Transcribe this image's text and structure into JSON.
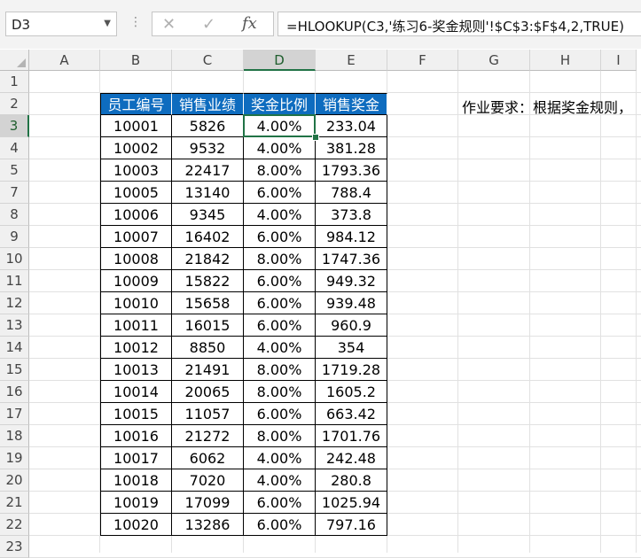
{
  "name_box": "D3",
  "formula": "=HLOOKUP(C3,'练习6-奖金规则'!$C$3:$F$4,2,TRUE)",
  "icons": {
    "cancel": "x-icon",
    "enter": "checkmark-icon",
    "function": "fx-icon",
    "more": "vertical-dots-icon",
    "dropdown": "chevron-down-icon"
  },
  "columns": [
    "A",
    "B",
    "C",
    "D",
    "E",
    "F",
    "G",
    "H",
    "I"
  ],
  "rows": [
    "1",
    "2",
    "3",
    "4",
    "5",
    "7",
    "8",
    "9",
    "10",
    "11",
    "12",
    "13",
    "14",
    "15",
    "16",
    "17",
    "18",
    "19",
    "20",
    "21",
    "22",
    "23"
  ],
  "selected_cell": {
    "column": "D",
    "row": "3"
  },
  "table": {
    "headers": [
      "员工编号",
      "销售业绩",
      "奖金比例",
      "销售奖金"
    ],
    "header_color": "#0E6CBF",
    "rows": [
      [
        "10001",
        "5826",
        "4.00%",
        "233.04"
      ],
      [
        "10002",
        "9532",
        "4.00%",
        "381.28"
      ],
      [
        "10003",
        "22417",
        "8.00%",
        "1793.36"
      ],
      [
        "10005",
        "13140",
        "6.00%",
        "788.4"
      ],
      [
        "10006",
        "9345",
        "4.00%",
        "373.8"
      ],
      [
        "10007",
        "16402",
        "6.00%",
        "984.12"
      ],
      [
        "10008",
        "21842",
        "8.00%",
        "1747.36"
      ],
      [
        "10009",
        "15822",
        "6.00%",
        "949.32"
      ],
      [
        "10010",
        "15658",
        "6.00%",
        "939.48"
      ],
      [
        "10011",
        "16015",
        "6.00%",
        "960.9"
      ],
      [
        "10012",
        "8850",
        "4.00%",
        "354"
      ],
      [
        "10013",
        "21491",
        "8.00%",
        "1719.28"
      ],
      [
        "10014",
        "20065",
        "8.00%",
        "1605.2"
      ],
      [
        "10015",
        "11057",
        "6.00%",
        "663.42"
      ],
      [
        "10016",
        "21272",
        "8.00%",
        "1701.76"
      ],
      [
        "10017",
        "6062",
        "4.00%",
        "242.48"
      ],
      [
        "10018",
        "7020",
        "4.00%",
        "280.8"
      ],
      [
        "10019",
        "17099",
        "6.00%",
        "1025.94"
      ],
      [
        "10020",
        "13286",
        "6.00%",
        "797.16"
      ]
    ]
  },
  "note": "作业要求：根据奖金规则，"
}
